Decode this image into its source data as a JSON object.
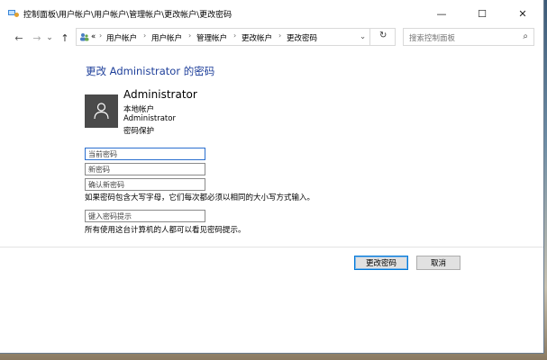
{
  "window": {
    "title": "控制面板\\用户帐户\\用户帐户\\管理帐户\\更改帐户\\更改密码",
    "controls": {
      "minimize": "—",
      "maximize": "☐",
      "close": "✕"
    }
  },
  "nav": {
    "back": "←",
    "forward": "→",
    "recent": "⌄",
    "up": "↑",
    "address": {
      "overflow": "«",
      "crumbs": [
        "用户帐户",
        "用户帐户",
        "管理帐户",
        "更改帐户",
        "更改密码"
      ],
      "separator": "›",
      "dropdown": "⌄",
      "refresh": "↻"
    },
    "search": {
      "placeholder": "搜索控制面板",
      "icon": "⌕"
    }
  },
  "page": {
    "heading": "更改 Administrator 的密码",
    "user": {
      "name": "Administrator",
      "lines": [
        "本地帐户",
        "Administrator",
        "密码保护"
      ]
    },
    "fields": {
      "current_password": "当前密码",
      "new_password": "新密码",
      "confirm_password": "确认新密码",
      "hint_input": "键入密码提示"
    },
    "case_note": "如果密码包含大写字母，它们每次都必须以相同的大小写方式输入。",
    "hint_note": "所有使用这台计算机的人都可以看见密码提示。"
  },
  "buttons": {
    "change": "更改密码",
    "cancel": "取消"
  }
}
